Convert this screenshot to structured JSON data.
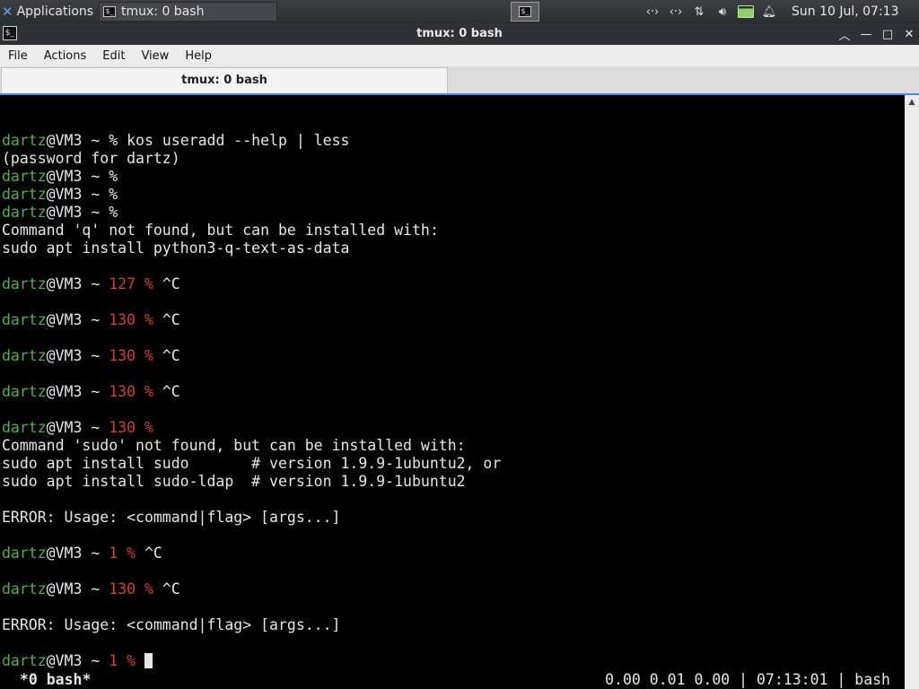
{
  "panel": {
    "apps_label": "Applications",
    "task_label": "tmux: 0 bash",
    "clock": "Sun 10 Jul, 07:13",
    "tray_icons": [
      "network-icon",
      "network-icon",
      "transfer-icon",
      "volume-icon",
      "battery-icon",
      "notification-bell-icon"
    ]
  },
  "window": {
    "title": "tmux: 0 bash",
    "menu": [
      "File",
      "Actions",
      "Edit",
      "View",
      "Help"
    ],
    "tab_label": "tmux: 0 bash"
  },
  "terminal": {
    "user_host": "dartz@VM3",
    "lines": [
      {
        "row": 0,
        "text": "dartz@VM3 ~ % kos useradd --help | less"
      },
      {
        "row": 1,
        "text": "(password for dartz)"
      },
      {
        "row": 2,
        "text": "dartz@VM3 ~ %"
      },
      {
        "row": 3,
        "text": "dartz@VM3 ~ %"
      },
      {
        "row": 4,
        "text": "dartz@VM3 ~ %"
      },
      {
        "row": 5,
        "text": "Command 'q' not found, but can be installed with:"
      },
      {
        "row": 6,
        "text": "sudo apt install python3-q-text-as-data"
      },
      {
        "row": 8,
        "text": "dartz@VM3 ~ 127 % ^C"
      },
      {
        "row": 10,
        "text": "dartz@VM3 ~ 130 % ^C"
      },
      {
        "row": 12,
        "text": "dartz@VM3 ~ 130 % ^C"
      },
      {
        "row": 14,
        "text": "dartz@VM3 ~ 130 % ^C"
      },
      {
        "row": 16,
        "text": "dartz@VM3 ~ 130 %"
      },
      {
        "row": 17,
        "text": "Command 'sudo' not found, but can be installed with:"
      },
      {
        "row": 18,
        "text": "sudo apt install sudo       # version 1.9.9-1ubuntu2, or"
      },
      {
        "row": 19,
        "text": "sudo apt install sudo-ldap  # version 1.9.9-1ubuntu2"
      },
      {
        "row": 21,
        "text": "ERROR: Usage: <command|flag> [args...]"
      },
      {
        "row": 23,
        "text": "dartz@VM3 ~ 1 % ^C"
      },
      {
        "row": 25,
        "text": "dartz@VM3 ~ 130 % ^C"
      },
      {
        "row": 27,
        "text": "ERROR: Usage: <command|flag> [args...]"
      },
      {
        "row": 29,
        "text": "dartz@VM3 ~ 1 % "
      }
    ],
    "status_left": " *0 bash*",
    "status_right": "0.00 0.01 0.00 | 07:13:01 | bash"
  },
  "colors": {
    "user_prompt": "#4eb04e",
    "exit_code": "#d43c3c",
    "terminal_bg": "#000000",
    "terminal_fg": "#e6e6e6",
    "tab_accent": "#3f8ee6"
  }
}
